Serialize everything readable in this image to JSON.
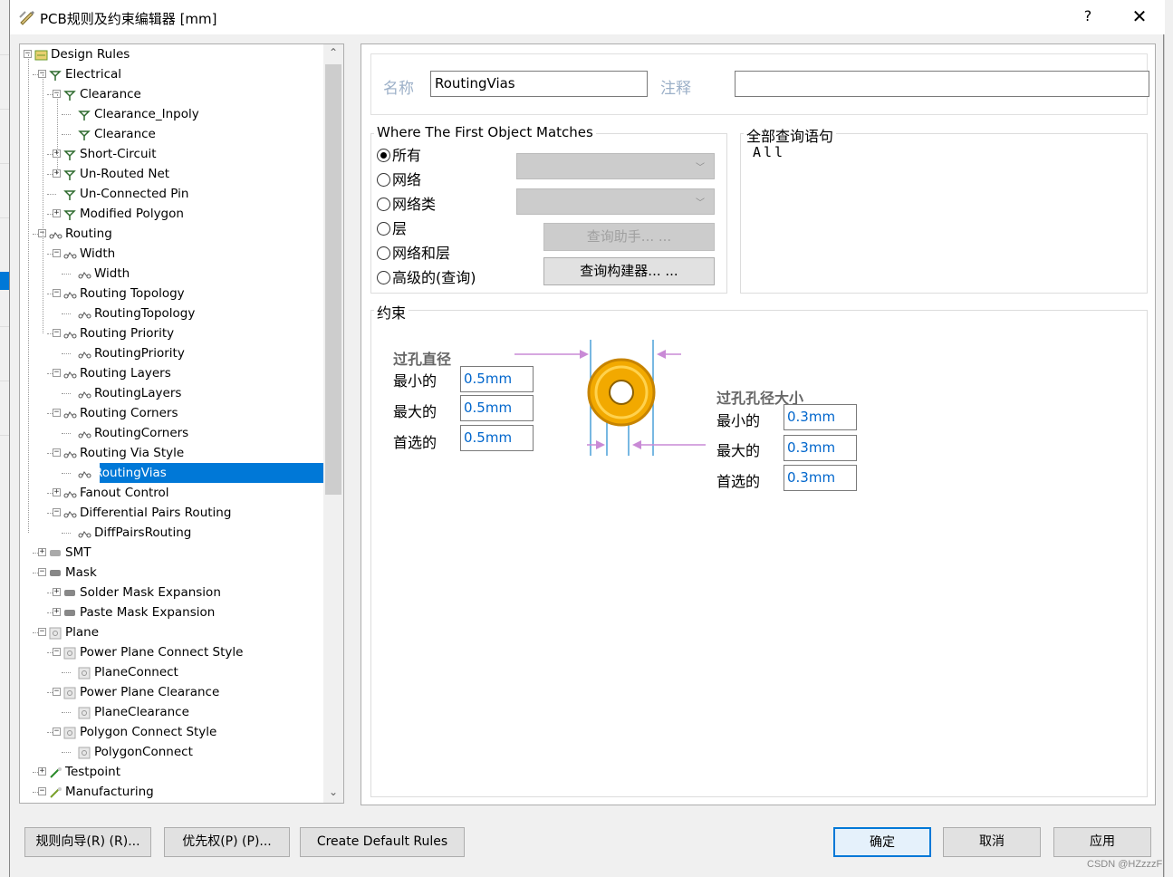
{
  "window": {
    "title": "PCB规则及约束编辑器 [mm]",
    "help": "?",
    "close": "✕"
  },
  "tree": {
    "nodes": [
      {
        "label": "Design Rules",
        "icon": "design-rules-icon",
        "expanded": true
      },
      {
        "label": "Electrical",
        "icon": "electrical-icon",
        "expanded": true
      },
      {
        "label": "Clearance",
        "icon": "clearance-icon",
        "expanded": true
      },
      {
        "label": "Clearance_Inpoly",
        "icon": "clearance-rule-icon"
      },
      {
        "label": "Clearance",
        "icon": "clearance-rule-icon"
      },
      {
        "label": "Short-Circuit",
        "icon": "short-circuit-icon",
        "expanded": false
      },
      {
        "label": "Un-Routed Net",
        "icon": "unrouted-net-icon",
        "expanded": false
      },
      {
        "label": "Un-Connected Pin",
        "icon": "unconnected-pin-icon"
      },
      {
        "label": "Modified Polygon",
        "icon": "modified-polygon-icon",
        "expanded": false
      },
      {
        "label": "Routing",
        "icon": "routing-icon",
        "expanded": true
      },
      {
        "label": "Width",
        "icon": "routing-icon",
        "expanded": true
      },
      {
        "label": "Width",
        "icon": "routing-rule-icon"
      },
      {
        "label": "Routing Topology",
        "icon": "routing-icon",
        "expanded": true
      },
      {
        "label": "RoutingTopology",
        "icon": "routing-rule-icon"
      },
      {
        "label": "Routing Priority",
        "icon": "routing-icon",
        "expanded": true
      },
      {
        "label": "RoutingPriority",
        "icon": "routing-rule-icon"
      },
      {
        "label": "Routing Layers",
        "icon": "routing-icon",
        "expanded": true
      },
      {
        "label": "RoutingLayers",
        "icon": "routing-rule-icon"
      },
      {
        "label": "Routing Corners",
        "icon": "routing-icon",
        "expanded": true
      },
      {
        "label": "RoutingCorners",
        "icon": "routing-rule-icon"
      },
      {
        "label": "Routing Via Style",
        "icon": "routing-icon",
        "expanded": true
      },
      {
        "label": "RoutingVias",
        "icon": "routing-rule-icon",
        "selected": true
      },
      {
        "label": "Fanout Control",
        "icon": "routing-icon",
        "expanded": false
      },
      {
        "label": "Differential Pairs Routing",
        "icon": "routing-icon",
        "expanded": true
      },
      {
        "label": "DiffPairsRouting",
        "icon": "routing-rule-icon"
      },
      {
        "label": "SMT",
        "icon": "smt-icon",
        "expanded": false
      },
      {
        "label": "Mask",
        "icon": "mask-icon",
        "expanded": true
      },
      {
        "label": "Solder Mask Expansion",
        "icon": "mask-icon",
        "expanded": false
      },
      {
        "label": "Paste Mask Expansion",
        "icon": "mask-icon",
        "expanded": false
      },
      {
        "label": "Plane",
        "icon": "plane-icon",
        "expanded": true
      },
      {
        "label": "Power Plane Connect Style",
        "icon": "plane-icon",
        "expanded": true
      },
      {
        "label": "PlaneConnect",
        "icon": "plane-rule-icon"
      },
      {
        "label": "Power Plane Clearance",
        "icon": "plane-icon",
        "expanded": true
      },
      {
        "label": "PlaneClearance",
        "icon": "plane-rule-icon"
      },
      {
        "label": "Polygon Connect Style",
        "icon": "plane-icon",
        "expanded": true
      },
      {
        "label": "PolygonConnect",
        "icon": "plane-rule-icon"
      },
      {
        "label": "Testpoint",
        "icon": "testpoint-icon",
        "expanded": false
      },
      {
        "label": "Manufacturing",
        "icon": "manufacturing-icon",
        "expanded": true
      }
    ]
  },
  "rule": {
    "name_label": "名称",
    "name_value": "RoutingVias",
    "comment_label": "注释",
    "comment_value": ""
  },
  "match": {
    "group_title": "Where The First Object Matches",
    "options": [
      "所有",
      "网络",
      "网络类",
      "层",
      "网络和层",
      "高级的(查询)"
    ],
    "selected": "所有",
    "query_helper": "查询助手... ...",
    "query_builder": "查询构建器... ..."
  },
  "query": {
    "group_title": "全部查询语句",
    "text": "All"
  },
  "constraints": {
    "group_title": "约束",
    "via_diameter": {
      "title": "过孔直径",
      "min_label": "最小的",
      "min": "0.5mm",
      "max_label": "最大的",
      "max": "0.5mm",
      "pref_label": "首选的",
      "pref": "0.5mm"
    },
    "hole_size": {
      "title": "过孔孔径大小",
      "min_label": "最小的",
      "min": "0.3mm",
      "max_label": "最大的",
      "max": "0.3mm",
      "pref_label": "首选的",
      "pref": "0.3mm"
    }
  },
  "buttons": {
    "rule_wizard": "规则向导(R) (R)...",
    "priorities": "优先权(P) (P)...",
    "create_default": "Create Default Rules",
    "ok": "确定",
    "cancel": "取消",
    "apply": "应用"
  },
  "colors": {
    "selection": "#0078d7",
    "value_text": "#0066cc",
    "via_ring": "#f2a900",
    "dimension_arrow": "#c98ad6"
  },
  "watermark": "CSDN @HZzzzF"
}
